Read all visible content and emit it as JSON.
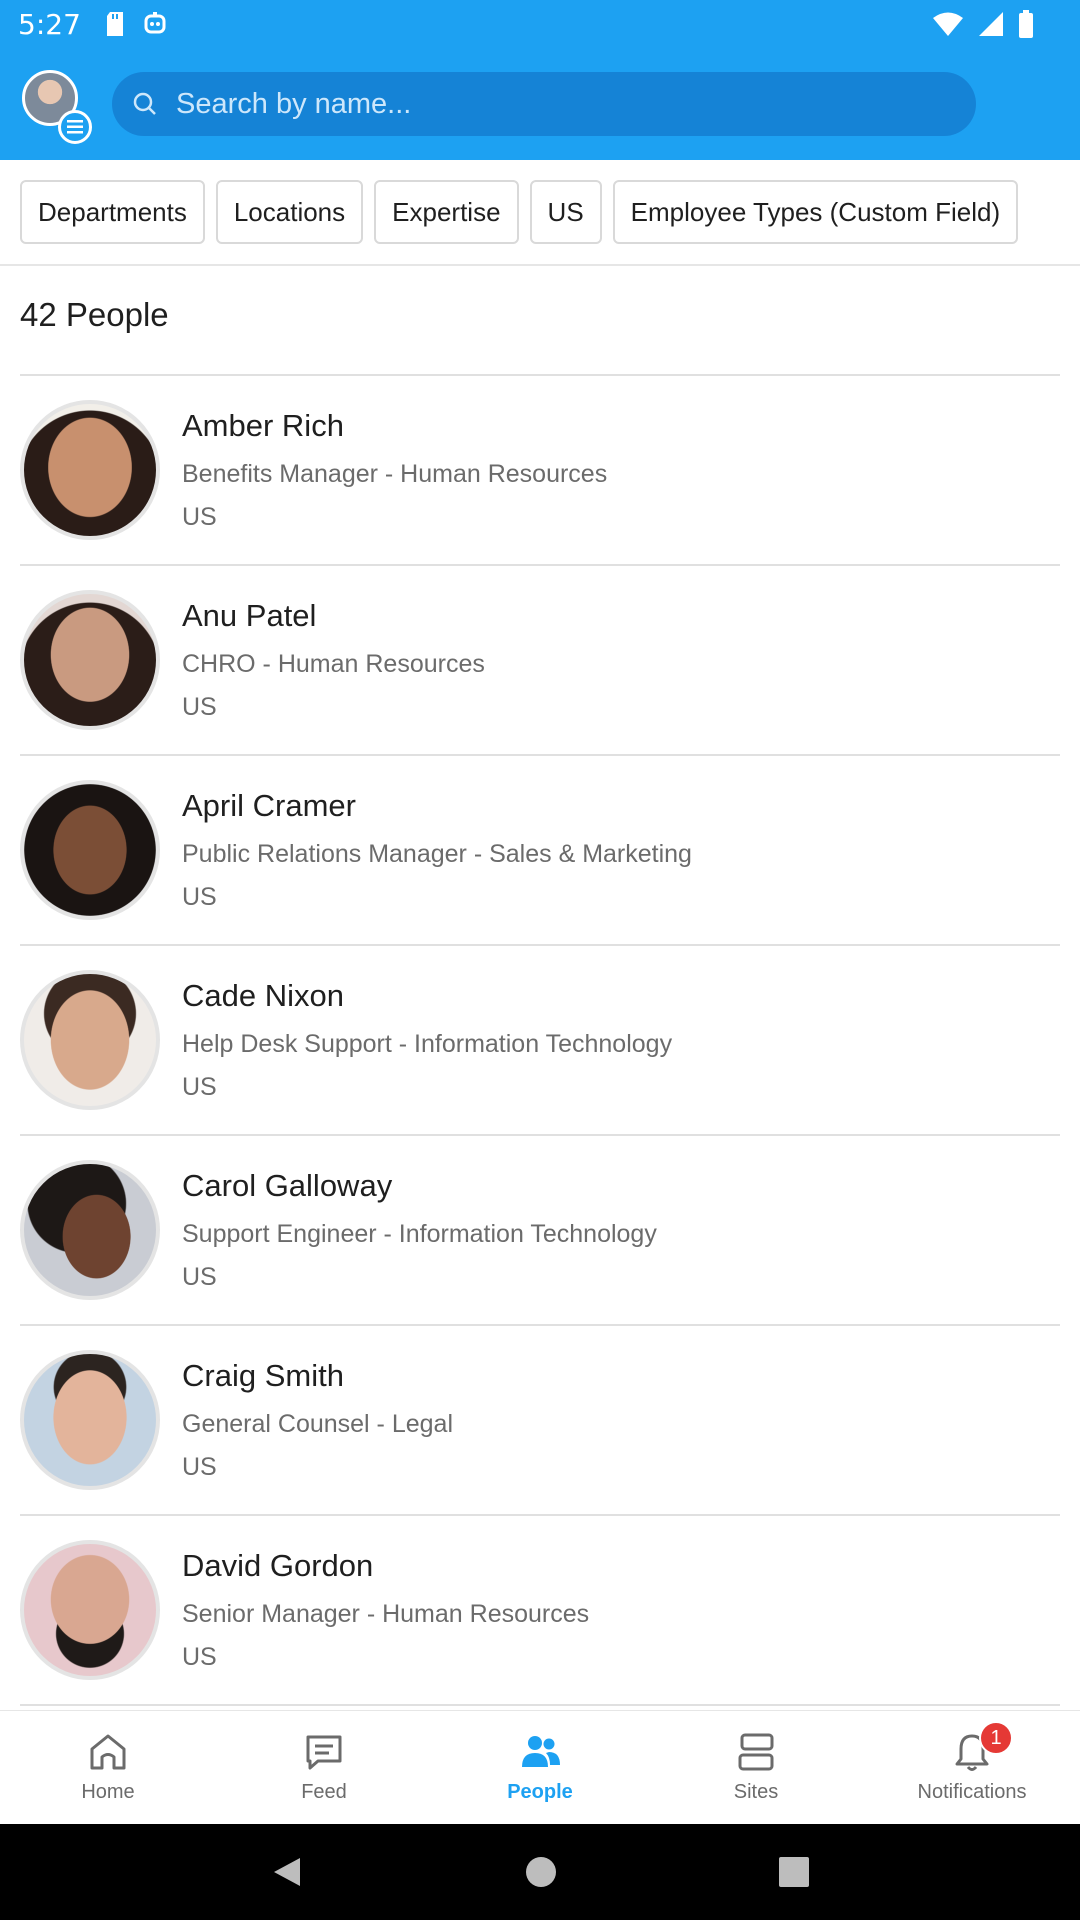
{
  "status_bar": {
    "time": "5:27"
  },
  "search": {
    "placeholder": "Search by name..."
  },
  "filters": [
    "Departments",
    "Locations",
    "Expertise",
    "US",
    "Employee Types (Custom Field)"
  ],
  "people_count": "42 People",
  "people": [
    {
      "name": "Amber Rich",
      "title": "Benefits Manager - Human Resources",
      "location": "US"
    },
    {
      "name": "Anu Patel",
      "title": "CHRO - Human Resources",
      "location": "US"
    },
    {
      "name": "April Cramer",
      "title": "Public Relations Manager - Sales & Marketing",
      "location": "US"
    },
    {
      "name": "Cade Nixon",
      "title": "Help Desk Support - Information Technology",
      "location": "US"
    },
    {
      "name": "Carol Galloway",
      "title": "Support Engineer - Information Technology",
      "location": "US"
    },
    {
      "name": "Craig Smith",
      "title": "General Counsel - Legal",
      "location": "US"
    },
    {
      "name": "David Gordon",
      "title": "Senior Manager - Human Resources",
      "location": "US"
    }
  ],
  "bottom_nav": [
    {
      "label": "Home",
      "icon": "home-icon"
    },
    {
      "label": "Feed",
      "icon": "feed-icon"
    },
    {
      "label": "People",
      "icon": "people-icon",
      "active": true
    },
    {
      "label": "Sites",
      "icon": "sites-icon"
    },
    {
      "label": "Notifications",
      "icon": "bell-icon",
      "badge": "1"
    }
  ],
  "colors": {
    "brand": "#1da1f2",
    "badge": "#e53935"
  }
}
